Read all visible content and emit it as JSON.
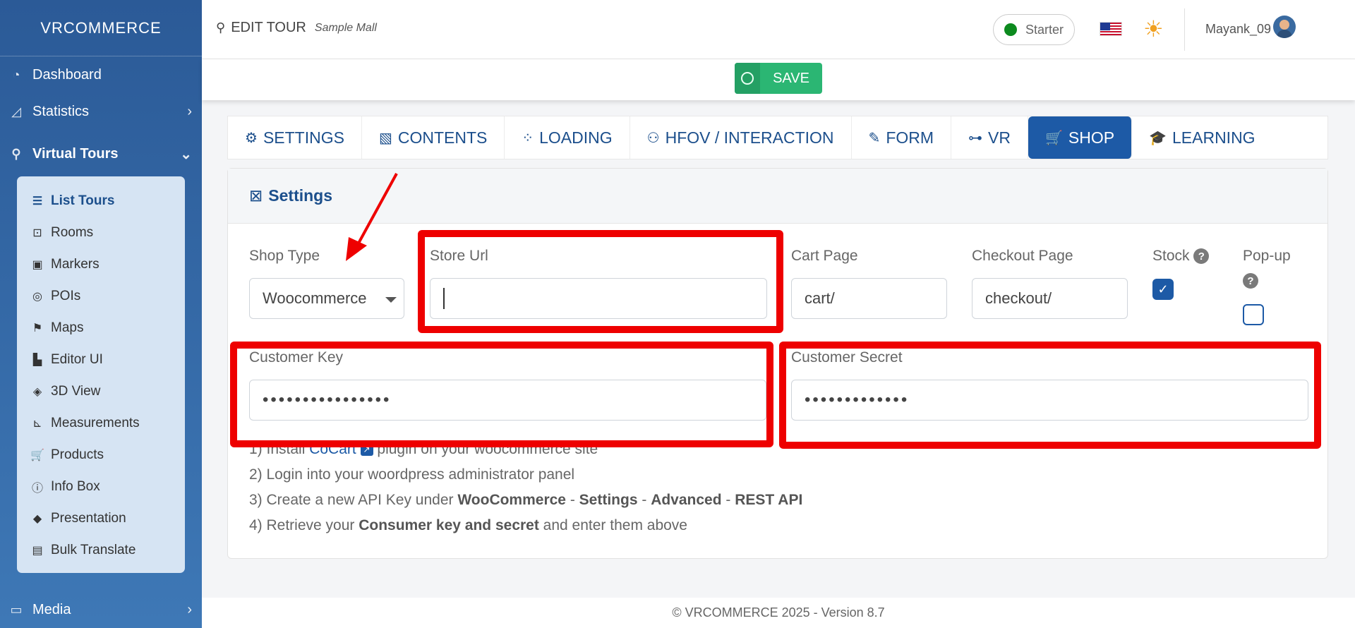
{
  "brand": {
    "logo": "VRCOMMERCE"
  },
  "sidebar": {
    "items": [
      {
        "label": "Dashboard",
        "icon": "gauge-icon"
      },
      {
        "label": "Statistics",
        "icon": "chart-area-icon"
      },
      {
        "label": "Virtual Tours",
        "icon": "route-icon"
      }
    ],
    "submenu": [
      {
        "label": "List Tours",
        "icon": "list-icon",
        "active": true
      },
      {
        "label": "Rooms",
        "icon": "vector-square-icon"
      },
      {
        "label": "Markers",
        "icon": "image-marker-icon"
      },
      {
        "label": "POIs",
        "icon": "bullseye-icon"
      },
      {
        "label": "Maps",
        "icon": "map-icon"
      },
      {
        "label": "Editor UI",
        "icon": "swatchbook-icon"
      },
      {
        "label": "3D View",
        "icon": "cube-icon"
      },
      {
        "label": "Measurements",
        "icon": "ruler-icon"
      },
      {
        "label": "Products",
        "icon": "cart-icon"
      },
      {
        "label": "Info Box",
        "icon": "info-circle-icon"
      },
      {
        "label": "Presentation",
        "icon": "directions-icon"
      },
      {
        "label": "Bulk Translate",
        "icon": "language-icon"
      }
    ],
    "media": {
      "label": "Media",
      "icon": "desktop-icon"
    }
  },
  "header": {
    "title": "EDIT TOUR",
    "subtitle": "Sample Mall",
    "plan": "Starter",
    "username": "Mayank_09"
  },
  "savebar": {
    "save_label": "SAVE"
  },
  "tabs": [
    {
      "label": "SETTINGS",
      "icon": "cogs-icon"
    },
    {
      "label": "CONTENTS",
      "icon": "images-icon"
    },
    {
      "label": "LOADING",
      "icon": "spinner-icon"
    },
    {
      "label": "HFOV / INTERACTION",
      "icon": "binoculars-icon"
    },
    {
      "label": "FORM",
      "icon": "file-signature-icon"
    },
    {
      "label": "VR",
      "icon": "vr-cardboard-icon"
    },
    {
      "label": "SHOP",
      "icon": "cart-icon",
      "active": true
    },
    {
      "label": "LEARNING",
      "icon": "graduation-cap-icon"
    }
  ],
  "settings": {
    "header": "Settings",
    "shop_type": {
      "label": "Shop Type",
      "value": "Woocommerce"
    },
    "store_url": {
      "label": "Store Url",
      "value": ""
    },
    "cart_page": {
      "label": "Cart Page",
      "value": "cart/"
    },
    "checkout_page": {
      "label": "Checkout Page",
      "value": "checkout/"
    },
    "stock": {
      "label": "Stock",
      "checked": true
    },
    "popup": {
      "label": "Pop-up",
      "checked": false
    },
    "customer_key": {
      "label": "Customer Key",
      "value": "••••••••••••••••"
    },
    "customer_secret": {
      "label": "Customer Secret",
      "value": "•••••••••••••"
    },
    "steps": {
      "s1_a": "1) Install ",
      "s1_link": "CoCart",
      "s1_b": " plugin on your woocommerce site",
      "s2": "2) Login into your woordpress administrator panel",
      "s3_a": "3) Create a new API Key under ",
      "s3_b1": "WooCommerce",
      "s3_sep1": " - ",
      "s3_b2": "Settings",
      "s3_sep2": " - ",
      "s3_b3": "Advanced",
      "s3_sep3": " - ",
      "s3_b4": "REST API",
      "s4_a": "4) Retrieve your ",
      "s4_b": "Consumer key and secret",
      "s4_c": " and enter them above"
    }
  },
  "footer": {
    "text": "© VRCOMMERCE 2025 - Version 8.7"
  },
  "colors": {
    "primary": "#1d5aa6",
    "save": "#2bb673",
    "sidebar": "#2b5a97",
    "annotation": "#ee0000"
  }
}
